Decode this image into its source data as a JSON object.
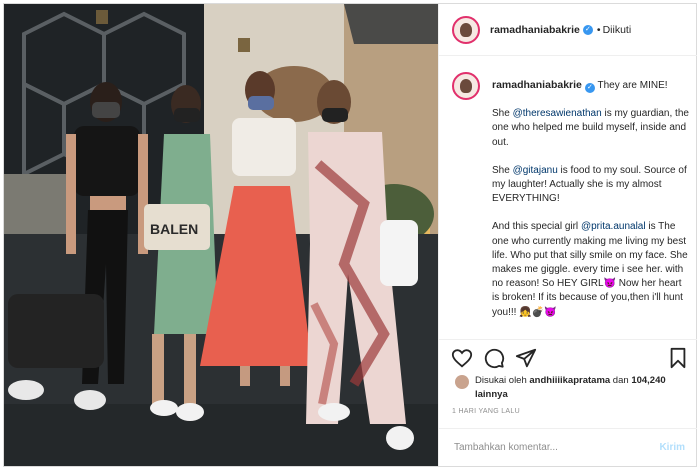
{
  "header": {
    "username": "ramadhaniabakrie",
    "separator": "•",
    "follow_status": "Diikuti",
    "verified_mark": "✓"
  },
  "caption": {
    "username": "ramadhaniabakrie",
    "first_line": "They are MINE!",
    "para1_before": "She ",
    "para1_mention": "@theresawienathan",
    "para1_after": " is my guardian, the one who helped me build myself, inside and out.",
    "para2_before": "She ",
    "para2_mention": "@gitajanu",
    "para2_after": " is food to my soul. Source of my laughter! Actually she is my almost EVERYTHING!",
    "para3_before": "And this special girl ",
    "para3_mention": "@prita.aunalal",
    "para3_after": " is The one who currently making me living my best life. Who put that silly smile on my face. She makes me giggle. every time i see her. with no reason! So HEY GIRL👿 Now her heart is broken! If its because of you,then i'll hunt you!!! 👧💣👿"
  },
  "actions": {
    "like_icon": "heart-icon",
    "comment_icon": "comment-icon",
    "share_icon": "share-icon",
    "save_icon": "bookmark-icon"
  },
  "likes": {
    "prefix": "Disukai oleh ",
    "liker": "andhiiiikapratama",
    "middle": " dan ",
    "count": "104,240 lainnya"
  },
  "timestamp": "1 HARI YANG LALU",
  "comment": {
    "placeholder": "Tambahkan komentar...",
    "post_label": "Kirim"
  },
  "photo_text": {
    "bag_print": "BALEN"
  },
  "colors": {
    "accent": "#3897f0",
    "mention": "#00376b",
    "muted": "#8e8e8e",
    "post_disabled": "#b2dffc"
  }
}
